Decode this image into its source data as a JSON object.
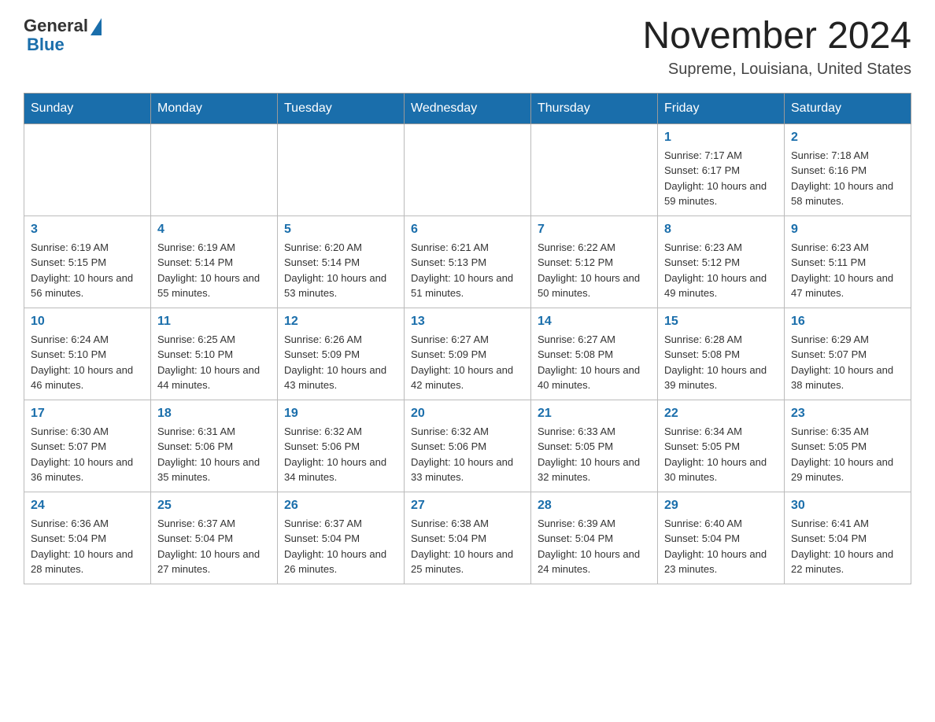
{
  "logo": {
    "general": "General",
    "blue": "Blue"
  },
  "header": {
    "month_title": "November 2024",
    "location": "Supreme, Louisiana, United States"
  },
  "weekdays": [
    "Sunday",
    "Monday",
    "Tuesday",
    "Wednesday",
    "Thursday",
    "Friday",
    "Saturday"
  ],
  "weeks": [
    [
      {
        "day": "",
        "info": ""
      },
      {
        "day": "",
        "info": ""
      },
      {
        "day": "",
        "info": ""
      },
      {
        "day": "",
        "info": ""
      },
      {
        "day": "",
        "info": ""
      },
      {
        "day": "1",
        "info": "Sunrise: 7:17 AM\nSunset: 6:17 PM\nDaylight: 10 hours and 59 minutes."
      },
      {
        "day": "2",
        "info": "Sunrise: 7:18 AM\nSunset: 6:16 PM\nDaylight: 10 hours and 58 minutes."
      }
    ],
    [
      {
        "day": "3",
        "info": "Sunrise: 6:19 AM\nSunset: 5:15 PM\nDaylight: 10 hours and 56 minutes."
      },
      {
        "day": "4",
        "info": "Sunrise: 6:19 AM\nSunset: 5:14 PM\nDaylight: 10 hours and 55 minutes."
      },
      {
        "day": "5",
        "info": "Sunrise: 6:20 AM\nSunset: 5:14 PM\nDaylight: 10 hours and 53 minutes."
      },
      {
        "day": "6",
        "info": "Sunrise: 6:21 AM\nSunset: 5:13 PM\nDaylight: 10 hours and 51 minutes."
      },
      {
        "day": "7",
        "info": "Sunrise: 6:22 AM\nSunset: 5:12 PM\nDaylight: 10 hours and 50 minutes."
      },
      {
        "day": "8",
        "info": "Sunrise: 6:23 AM\nSunset: 5:12 PM\nDaylight: 10 hours and 49 minutes."
      },
      {
        "day": "9",
        "info": "Sunrise: 6:23 AM\nSunset: 5:11 PM\nDaylight: 10 hours and 47 minutes."
      }
    ],
    [
      {
        "day": "10",
        "info": "Sunrise: 6:24 AM\nSunset: 5:10 PM\nDaylight: 10 hours and 46 minutes."
      },
      {
        "day": "11",
        "info": "Sunrise: 6:25 AM\nSunset: 5:10 PM\nDaylight: 10 hours and 44 minutes."
      },
      {
        "day": "12",
        "info": "Sunrise: 6:26 AM\nSunset: 5:09 PM\nDaylight: 10 hours and 43 minutes."
      },
      {
        "day": "13",
        "info": "Sunrise: 6:27 AM\nSunset: 5:09 PM\nDaylight: 10 hours and 42 minutes."
      },
      {
        "day": "14",
        "info": "Sunrise: 6:27 AM\nSunset: 5:08 PM\nDaylight: 10 hours and 40 minutes."
      },
      {
        "day": "15",
        "info": "Sunrise: 6:28 AM\nSunset: 5:08 PM\nDaylight: 10 hours and 39 minutes."
      },
      {
        "day": "16",
        "info": "Sunrise: 6:29 AM\nSunset: 5:07 PM\nDaylight: 10 hours and 38 minutes."
      }
    ],
    [
      {
        "day": "17",
        "info": "Sunrise: 6:30 AM\nSunset: 5:07 PM\nDaylight: 10 hours and 36 minutes."
      },
      {
        "day": "18",
        "info": "Sunrise: 6:31 AM\nSunset: 5:06 PM\nDaylight: 10 hours and 35 minutes."
      },
      {
        "day": "19",
        "info": "Sunrise: 6:32 AM\nSunset: 5:06 PM\nDaylight: 10 hours and 34 minutes."
      },
      {
        "day": "20",
        "info": "Sunrise: 6:32 AM\nSunset: 5:06 PM\nDaylight: 10 hours and 33 minutes."
      },
      {
        "day": "21",
        "info": "Sunrise: 6:33 AM\nSunset: 5:05 PM\nDaylight: 10 hours and 32 minutes."
      },
      {
        "day": "22",
        "info": "Sunrise: 6:34 AM\nSunset: 5:05 PM\nDaylight: 10 hours and 30 minutes."
      },
      {
        "day": "23",
        "info": "Sunrise: 6:35 AM\nSunset: 5:05 PM\nDaylight: 10 hours and 29 minutes."
      }
    ],
    [
      {
        "day": "24",
        "info": "Sunrise: 6:36 AM\nSunset: 5:04 PM\nDaylight: 10 hours and 28 minutes."
      },
      {
        "day": "25",
        "info": "Sunrise: 6:37 AM\nSunset: 5:04 PM\nDaylight: 10 hours and 27 minutes."
      },
      {
        "day": "26",
        "info": "Sunrise: 6:37 AM\nSunset: 5:04 PM\nDaylight: 10 hours and 26 minutes."
      },
      {
        "day": "27",
        "info": "Sunrise: 6:38 AM\nSunset: 5:04 PM\nDaylight: 10 hours and 25 minutes."
      },
      {
        "day": "28",
        "info": "Sunrise: 6:39 AM\nSunset: 5:04 PM\nDaylight: 10 hours and 24 minutes."
      },
      {
        "day": "29",
        "info": "Sunrise: 6:40 AM\nSunset: 5:04 PM\nDaylight: 10 hours and 23 minutes."
      },
      {
        "day": "30",
        "info": "Sunrise: 6:41 AM\nSunset: 5:04 PM\nDaylight: 10 hours and 22 minutes."
      }
    ]
  ]
}
